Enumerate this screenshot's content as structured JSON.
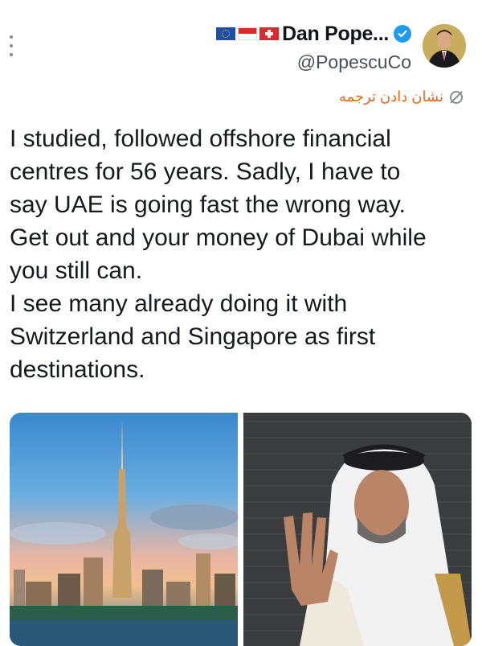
{
  "header": {
    "flags": [
      "eu-flag",
      "monaco-flag",
      "switzerland-flag"
    ],
    "display_name": "Dan Pope...",
    "handle": "@PopescuCo",
    "verified": true,
    "accent": "#1d9bf0"
  },
  "translate": {
    "label": "نشان دادن ترجمه",
    "icon": "translate-icon",
    "color": "#e36a1b"
  },
  "tweet": {
    "lines": [
      "I studied, followed offshore financial",
      "centres for 56 years. Sadly, I have to",
      "say UAE is going fast the wrong way.",
      "Get out and your money of Dubai while",
      "you still can.",
      "I see many already doing it with",
      "Switzerland and Singapore as first",
      "destinations."
    ]
  },
  "media": [
    {
      "name": "dubai-skyline-photo"
    },
    {
      "name": "man-waving-photo"
    }
  ]
}
